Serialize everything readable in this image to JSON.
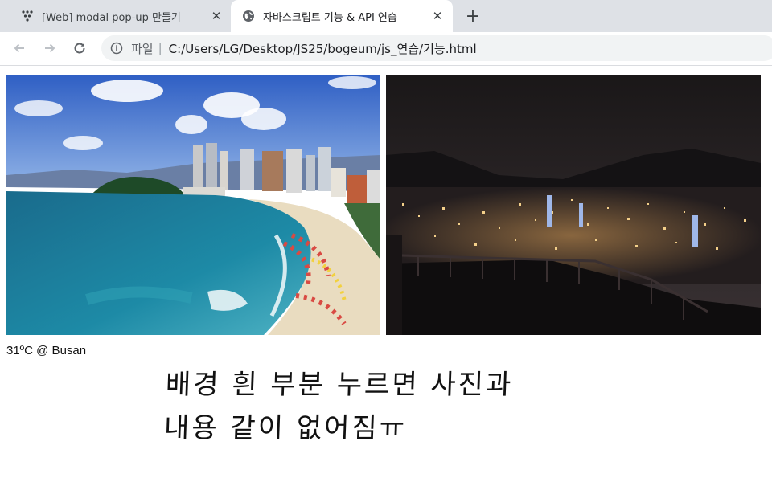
{
  "browser": {
    "tabs": [
      {
        "title": "[Web] modal pop-up 만들기",
        "active": false,
        "icon": "app-dots-icon"
      },
      {
        "title": "자바스크립트 기능 & API 연습",
        "active": true,
        "icon": "globe-icon"
      }
    ],
    "new_tab_icon": "plus-icon",
    "address_bar": {
      "scheme_label": "파일",
      "url": "C:/Users/LG/Desktop/JS25/bogeum/js_연습/기능.html"
    }
  },
  "page": {
    "images": [
      {
        "name": "busan-beach-photo"
      },
      {
        "name": "busan-night-view-photo"
      }
    ],
    "weather_text": "31ºC @ Busan"
  },
  "annotation": {
    "line1": "배경 흰 부분 누르면 사진과",
    "line2": "내용 같이 없어짐ㅠ"
  },
  "colors": {
    "tabstrip_bg": "#dee1e6",
    "active_tab_bg": "#ffffff",
    "omnibox_bg": "#f1f3f4"
  }
}
